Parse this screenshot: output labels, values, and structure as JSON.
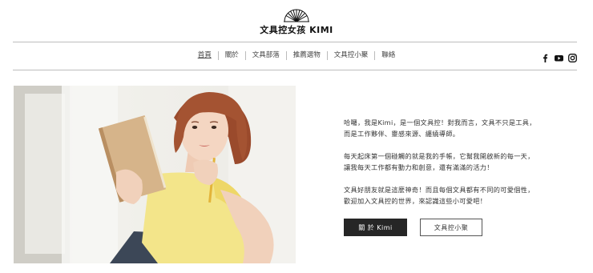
{
  "brand": {
    "logo_text": "文具控女孩 KIMI"
  },
  "nav": {
    "items": [
      {
        "label": "首頁",
        "active": true
      },
      {
        "label": "關於",
        "active": false
      },
      {
        "label": "文具部落",
        "active": false
      },
      {
        "label": "推薦選物",
        "active": false
      },
      {
        "label": "文具控小聚",
        "active": false
      },
      {
        "label": "聯絡",
        "active": false
      }
    ]
  },
  "social": {
    "icons": [
      "facebook-icon",
      "youtube-icon",
      "instagram-icon"
    ]
  },
  "intro": {
    "paragraph1": "哈囉，我是Kimi，是一個文具控！對我而言，文具不只是工具，而是工作夥伴、靈感來源、纏繞導師。",
    "paragraph2": "每天起床第一個碰觸的就是我的手帳，它幫我開啟新的每一天，讓我每天工作都有動力和創意，還有滿滿的活力！",
    "paragraph3": "文具好朋友就是這麼神奇！而且每個文具都有不同的可愛個性，歡迎加入文具控的世界，來認識這些小可愛吧！"
  },
  "buttons": {
    "about_label": "關 於 Kimi",
    "meetup_label": "文具控小聚"
  },
  "colors": {
    "primary_button": "#262626",
    "hero_background": "#eceae4",
    "top_color": "#f3e58a",
    "hair_color": "#9a4a2c",
    "notebook_color": "#d6b48a"
  }
}
